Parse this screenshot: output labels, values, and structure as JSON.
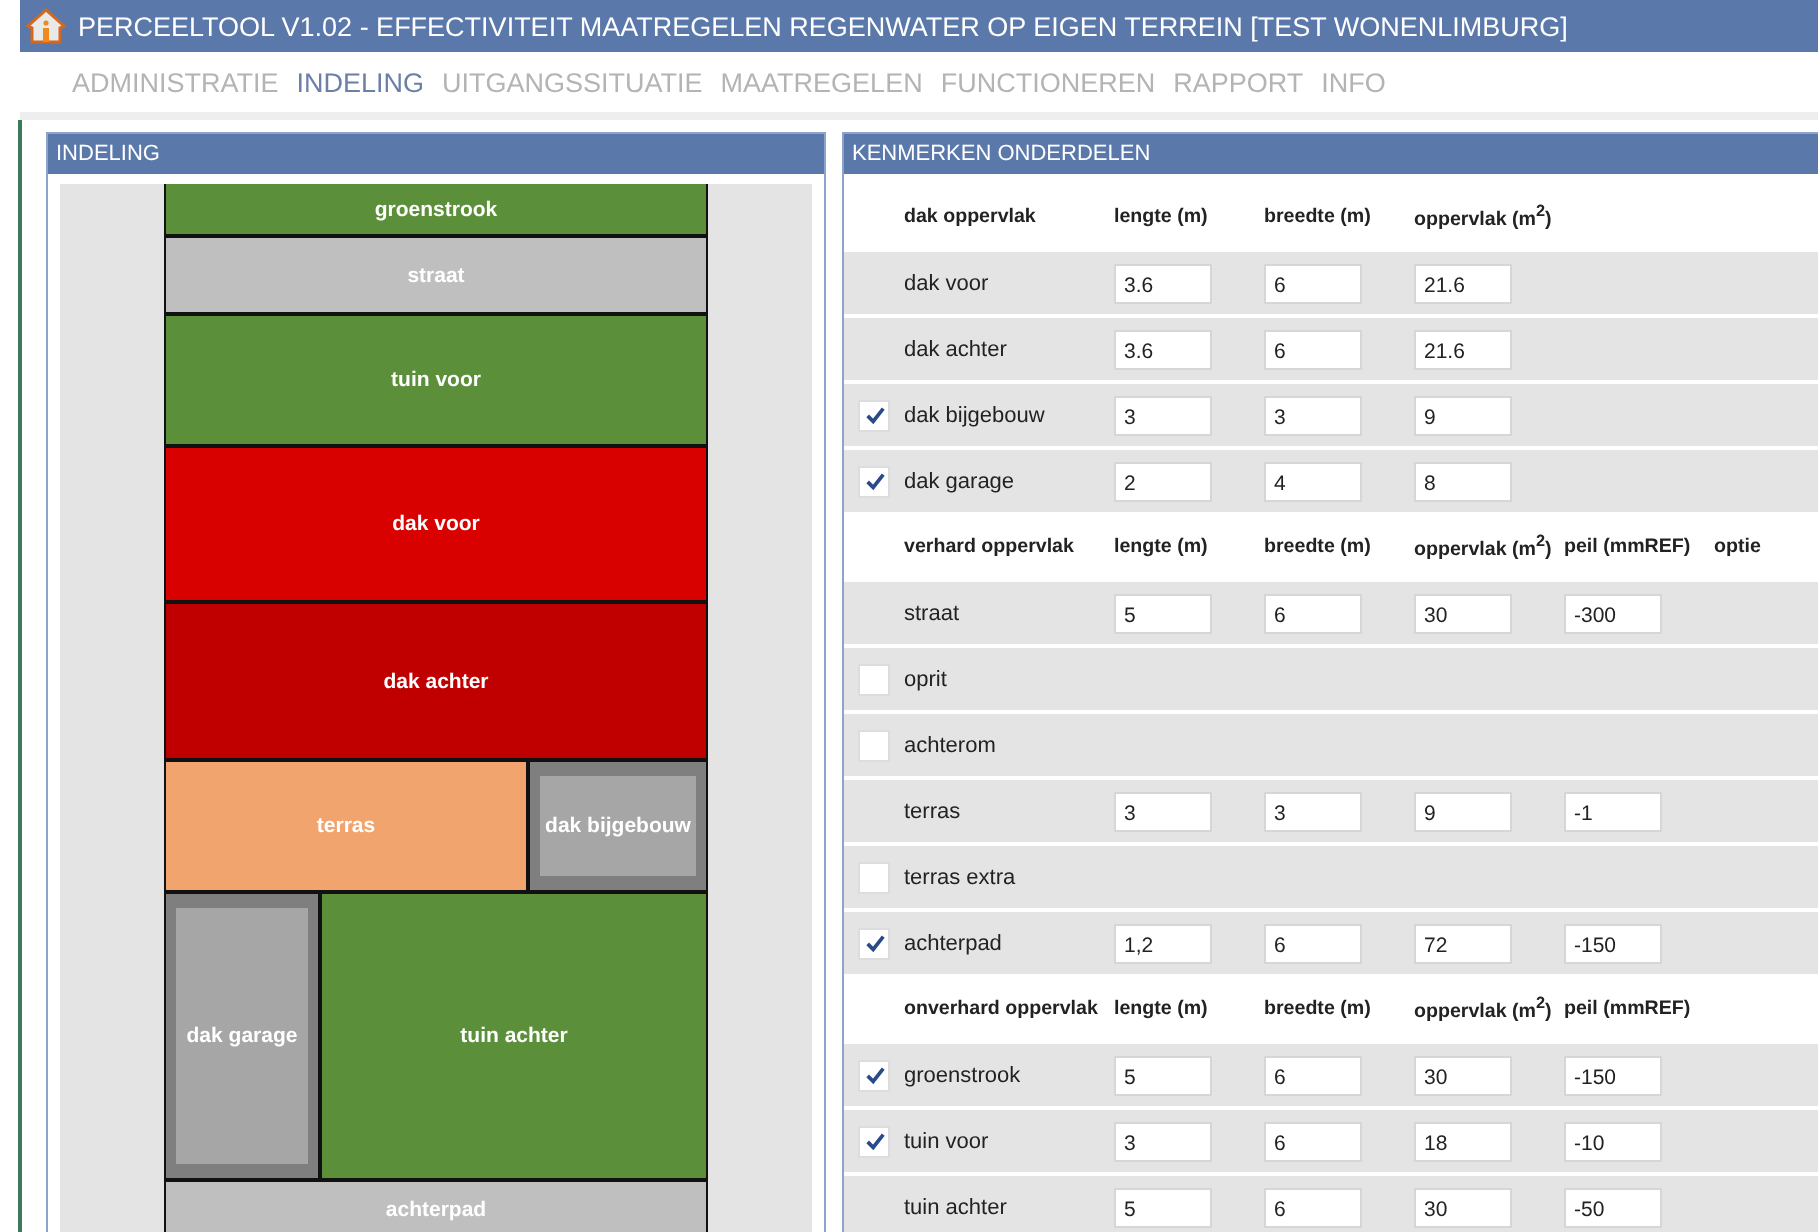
{
  "window": {
    "title": "PERCEELTOOL V1.02 - EFFECTIVITEIT MAATREGELEN REGENWATER OP EIGEN TERREIN [TEST WONENLIMBURG]"
  },
  "menu": [
    {
      "label": "ADMINISTRATIE",
      "selected": false
    },
    {
      "label": "INDELING",
      "selected": true
    },
    {
      "label": "UITGANGSSITUATIE",
      "selected": false
    },
    {
      "label": "MAATREGELEN",
      "selected": false
    },
    {
      "label": "FUNCTIONEREN",
      "selected": false
    },
    {
      "label": "RAPPORT",
      "selected": false
    },
    {
      "label": "INFO",
      "selected": false
    }
  ],
  "layout_panel": {
    "title": "INDELING",
    "blocks": [
      {
        "label": "groenstrook",
        "kind": "area",
        "color": "#5b8f3a"
      },
      {
        "label": "straat",
        "kind": "area",
        "color": "#bfbfbf"
      },
      {
        "label": "tuin voor",
        "kind": "area",
        "color": "#5b8f3a"
      },
      {
        "label": "dak voor",
        "kind": "area",
        "color": "#d90000"
      },
      {
        "label": "dak achter",
        "kind": "area",
        "color": "#c00000"
      },
      {
        "label": "terras",
        "kind": "area",
        "color": "#f2a46e"
      },
      {
        "label": "dak bijgebouw",
        "kind": "building",
        "color": "#a6a6a6"
      },
      {
        "label": "dak garage",
        "kind": "building",
        "color": "#a6a6a6"
      },
      {
        "label": "tuin achter",
        "kind": "area",
        "color": "#5b8f3a"
      },
      {
        "label": "achterpad",
        "kind": "area",
        "color": "#bfbfbf"
      }
    ]
  },
  "properties_panel": {
    "title": "KENMERKEN ONDERDELEN",
    "sections": [
      {
        "columns": [
          "dak oppervlak",
          "lengte (m)",
          "breedte (m)",
          "oppervlak (m$^{2}$)"
        ],
        "rows": [
          {
            "label": "dak voor",
            "kind": "fixed",
            "values": [
              "3.6",
              "6",
              "21.6"
            ]
          },
          {
            "label": "dak achter",
            "kind": "fixed",
            "values": [
              "3.6",
              "6",
              "21.6"
            ]
          },
          {
            "label": "dak bijgebouw",
            "kind": "optional",
            "checked": true,
            "values": [
              "3",
              "3",
              "9"
            ]
          },
          {
            "label": "dak garage",
            "kind": "optional",
            "checked": true,
            "values": [
              "2",
              "4",
              "8"
            ]
          }
        ]
      },
      {
        "columns": [
          "verhard oppervlak",
          "lengte (m)",
          "breedte (m)",
          "oppervlak (m$^{2}$)",
          "peil (mmREF)",
          "optie"
        ],
        "rows": [
          {
            "label": "straat",
            "kind": "fixed",
            "values": [
              "5",
              "6",
              "30",
              "-300"
            ]
          },
          {
            "label": "oprit",
            "kind": "optional",
            "checked": false,
            "values": []
          },
          {
            "label": "achterom",
            "kind": "optional",
            "checked": false,
            "values": []
          },
          {
            "label": "terras",
            "kind": "fixed",
            "values": [
              "3",
              "3",
              "9",
              "-1"
            ]
          },
          {
            "label": "terras extra",
            "kind": "optional",
            "checked": false,
            "values": []
          },
          {
            "label": "achterpad",
            "kind": "optional",
            "checked": true,
            "values": [
              "1,2",
              "6",
              "72",
              "-150"
            ]
          }
        ]
      },
      {
        "columns": [
          "onverhard oppervlak",
          "lengte (m)",
          "breedte (m)",
          "oppervlak (m$^{2}$)",
          "peil (mmREF)"
        ],
        "rows": [
          {
            "label": "groenstrook",
            "kind": "optional",
            "checked": true,
            "values": [
              "5",
              "6",
              "30",
              "-150"
            ]
          },
          {
            "label": "tuin voor",
            "kind": "optional",
            "checked": true,
            "values": [
              "3",
              "6",
              "18",
              "-10"
            ]
          },
          {
            "label": "tuin achter",
            "kind": "fixed",
            "values": [
              "5",
              "6",
              "30",
              "-50"
            ]
          }
        ]
      }
    ]
  }
}
